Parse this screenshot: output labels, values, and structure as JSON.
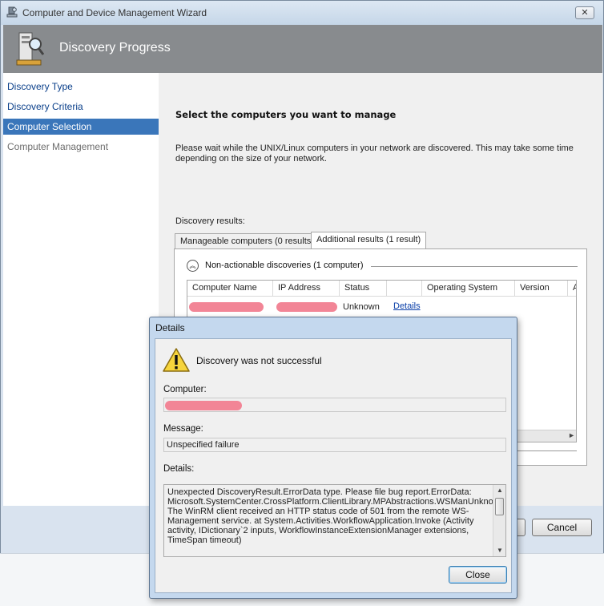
{
  "window": {
    "title": "Computer and Device Management Wizard",
    "close_symbol": "✕",
    "icon": "wizard-app-icon"
  },
  "banner": {
    "title": "Discovery Progress",
    "icon": "computer-discovery-icon"
  },
  "nav": {
    "items": [
      {
        "label": "Discovery Type",
        "state": "normal"
      },
      {
        "label": "Discovery Criteria",
        "state": "normal"
      },
      {
        "label": "Computer Selection",
        "state": "active"
      },
      {
        "label": "Computer Management",
        "state": "disabled"
      }
    ]
  },
  "main": {
    "heading": "Select the computers you want to manage",
    "description": "Please wait while the UNIX/Linux computers in your network are discovered. This may take some time depending on the size of your network.",
    "results_label": "Discovery results:",
    "tabs": [
      {
        "label": "Manageable computers (0 results)",
        "active": false
      },
      {
        "label": "Additional results (1 result)",
        "active": true
      }
    ],
    "group": {
      "label": "Non-actionable discoveries (1 computer)",
      "toggle_symbol": "︽"
    },
    "table": {
      "columns": [
        "Computer Name",
        "IP Address",
        "Status",
        "",
        "Operating System",
        "Version",
        "A"
      ],
      "rows": [
        {
          "computer_name": "",
          "ip_address": "",
          "status": "Unknown",
          "link": "Details"
        }
      ]
    },
    "scroll_right_symbol": "►",
    "buttons": {
      "cancel": "Cancel"
    }
  },
  "dialog": {
    "title": "Details",
    "message": "Discovery was not successful",
    "computer_label": "Computer:",
    "computer_value": "",
    "message_label": "Message:",
    "message_value": "Unspecified failure",
    "details_label": "Details:",
    "details_value": "Unexpected DiscoveryResult.ErrorData type.  Please file bug report.ErrorData: Microsoft.SystemCenter.CrossPlatform.ClientLibrary.MPAbstractions.WSManUnknownErrorException The WinRM client received an HTTP status code of 501 from the remote WS-Management service.    at System.Activities.WorkflowApplication.Invoke (Activity activity, IDictionary`2 inputs, WorkflowInstanceExtensionManager extensions, TimeSpan timeout)",
    "close_button": "Close",
    "icon": "warning-icon",
    "scroll_up_symbol": "▲",
    "scroll_down_symbol": "▼"
  },
  "colors": {
    "banner": "#888b8e",
    "nav_active": "#3a76ba",
    "link": "#0a3fa8",
    "redaction": "#f28596",
    "dialog_frame": "#c4d8ee"
  }
}
